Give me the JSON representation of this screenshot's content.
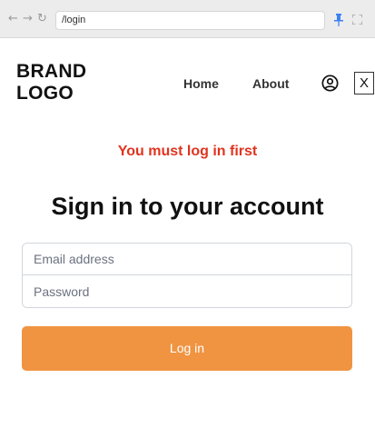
{
  "browser": {
    "url": "/login",
    "icons": {
      "back": "arrow-left-icon",
      "forward": "arrow-right-icon",
      "reload": "reload-icon",
      "pin": "pin-icon",
      "fullscreen": "fullscreen-icon"
    }
  },
  "header": {
    "brand_line1": "BRAND",
    "brand_line2": "LOGO",
    "nav": [
      {
        "label": "Home"
      },
      {
        "label": "About"
      }
    ],
    "user_icon": "user-circle-icon",
    "close_label": "X"
  },
  "alert": {
    "message": "You must log in first",
    "color": "#e0341f"
  },
  "form": {
    "title": "Sign in to your account",
    "email_placeholder": "Email address",
    "email_value": "",
    "password_placeholder": "Password",
    "password_value": "",
    "submit_label": "Log in",
    "submit_color": "#f09442"
  }
}
